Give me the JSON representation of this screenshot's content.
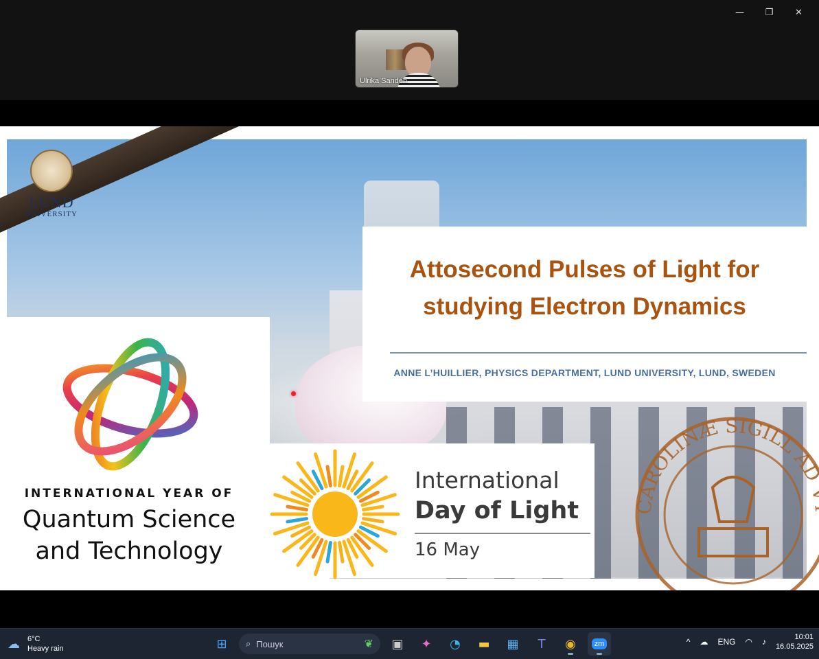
{
  "window": {
    "controls": {
      "minimize": "—",
      "restore": "❐",
      "close": "✕"
    }
  },
  "participant": {
    "name": "Ulrika Sandén"
  },
  "slide": {
    "lund_logo": {
      "word": "LUND",
      "sub": "UNIVERSITY"
    },
    "title_line1": "Attosecond Pulses of Light for",
    "title_line2": "studying Electron Dynamics",
    "author": "ANNE L’HUILLIER, PHYSICS DEPARTMENT, LUND UNIVERSITY, LUND, SWEDEN",
    "iyq": {
      "line1": "INTERNATIONAL YEAR OF",
      "line2": "Quantum Science",
      "line3": "and Technology"
    },
    "idl": {
      "line1": "International",
      "line2": "Day of Light",
      "date": "16 May"
    },
    "seal_text": "CAROLINÆ SIGILL AD VT RVMQVE ORVM"
  },
  "taskbar": {
    "weather": {
      "temp": "6°C",
      "desc": "Heavy rain"
    },
    "search_placeholder": "Пошук",
    "tray": {
      "lang": "ENG",
      "time": "10:01",
      "date": "16.05.2025"
    }
  },
  "colors": {
    "title": "#a8530f",
    "author": "#4a6e9b",
    "taskbar": "#1d2533"
  }
}
